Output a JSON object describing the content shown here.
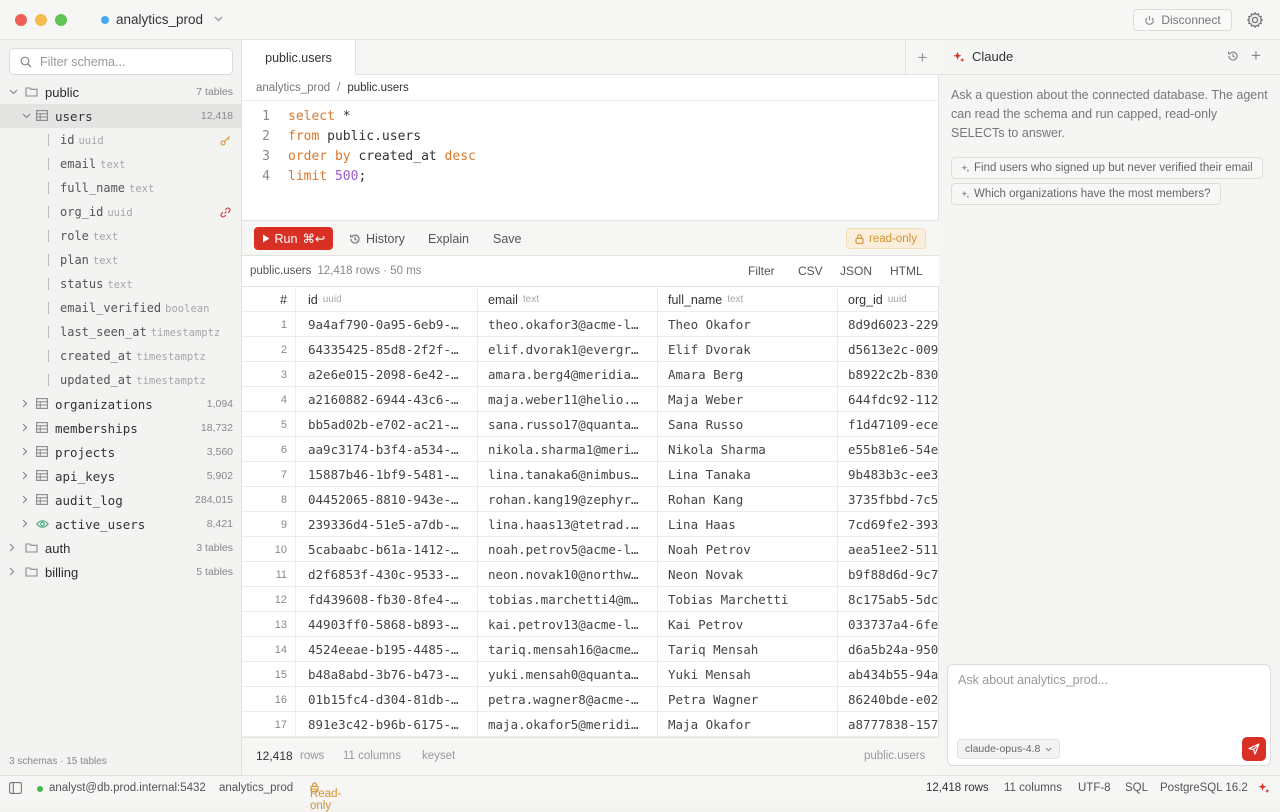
{
  "window": {
    "connection_name": "analytics_prod",
    "disconnect_label": "Disconnect",
    "connection_dot_color": "#45a8f0"
  },
  "sidebar": {
    "filter_placeholder": "Filter schema...",
    "schemas": [
      {
        "name": "public",
        "count": "7 tables"
      },
      {
        "name": "auth",
        "count": "3 tables"
      },
      {
        "name": "billing",
        "count": "5 tables"
      }
    ],
    "selected_table": {
      "name": "users",
      "count": "12,418"
    },
    "columns": [
      {
        "name": "id",
        "type": "uuid",
        "key": "primary-key"
      },
      {
        "name": "email",
        "type": "text"
      },
      {
        "name": "full_name",
        "type": "text"
      },
      {
        "name": "org_id",
        "type": "uuid",
        "key": "foreign-key"
      },
      {
        "name": "role",
        "type": "text"
      },
      {
        "name": "plan",
        "type": "text"
      },
      {
        "name": "status",
        "type": "text"
      },
      {
        "name": "email_verified",
        "type": "boolean"
      },
      {
        "name": "last_seen_at",
        "type": "timestamptz"
      },
      {
        "name": "created_at",
        "type": "timestamptz"
      },
      {
        "name": "updated_at",
        "type": "timestamptz"
      }
    ],
    "tables": [
      {
        "name": "organizations",
        "count": "1,094",
        "icon": "table-icon"
      },
      {
        "name": "memberships",
        "count": "18,732",
        "icon": "table-icon"
      },
      {
        "name": "projects",
        "count": "3,560",
        "icon": "table-icon"
      },
      {
        "name": "api_keys",
        "count": "5,902",
        "icon": "table-icon"
      },
      {
        "name": "audit_log",
        "count": "284,015",
        "icon": "table-icon"
      },
      {
        "name": "active_users",
        "count": "8,421",
        "icon": "view-icon"
      }
    ],
    "footer": "3 schemas · 15 tables"
  },
  "editor": {
    "tab_label": "public.users",
    "breadcrumb": [
      "analytics_prod",
      "/",
      "public.users"
    ],
    "lines": [
      "1",
      "2",
      "3",
      "4"
    ],
    "toolbar": {
      "run_label": "Run",
      "run_shortcut": "⌘↩",
      "history_label": "History",
      "explain_label": "Explain",
      "save_label": "Save",
      "readonly_label": "read-only"
    }
  },
  "results": {
    "source": "public.users",
    "meta": "12,418 rows · 50 ms",
    "exports": [
      "Filter",
      "CSV",
      "JSON",
      "HTML"
    ],
    "row_header": "#",
    "columns": [
      {
        "name": "id",
        "type": "uuid"
      },
      {
        "name": "email",
        "type": "text"
      },
      {
        "name": "full_name",
        "type": "text"
      },
      {
        "name": "org_id",
        "type": "uuid"
      }
    ],
    "rows": [
      [
        "1",
        "9a4af790-0a95-6eb9-…",
        "theo.okafor3@acme-l…",
        "Theo Okafor",
        "8d9d6023-229"
      ],
      [
        "2",
        "64335425-85d8-2f2f-…",
        "elif.dvorak1@evergr…",
        "Elif Dvorak",
        "d5613e2c-009"
      ],
      [
        "3",
        "a2e6e015-2098-6e42-…",
        "amara.berg4@meridia…",
        "Amara Berg",
        "b8922c2b-830"
      ],
      [
        "4",
        "a2160882-6944-43c6-…",
        "maja.weber11@helio.…",
        "Maja Weber",
        "644fdc92-112"
      ],
      [
        "5",
        "bb5ad02b-e702-ac21-…",
        "sana.russo17@quanta…",
        "Sana Russo",
        "f1d47109-ece"
      ],
      [
        "6",
        "aa9c3174-b3f4-a534-…",
        "nikola.sharma1@meri…",
        "Nikola Sharma",
        "e55b81e6-54e"
      ],
      [
        "7",
        "15887b46-1bf9-5481-…",
        "lina.tanaka6@nimbus…",
        "Lina Tanaka",
        "9b483b3c-ee3"
      ],
      [
        "8",
        "04452065-8810-943e-…",
        "rohan.kang19@zephyr…",
        "Rohan Kang",
        "3735fbbd-7c5"
      ],
      [
        "9",
        "239336d4-51e5-a7db-…",
        "lina.haas13@tetrad.…",
        "Lina Haas",
        "7cd69fe2-393"
      ],
      [
        "10",
        "5cabaabc-b61a-1412-…",
        "noah.petrov5@acme-l…",
        "Noah Petrov",
        "aea51ee2-511"
      ],
      [
        "11",
        "d2f6853f-430c-9533-…",
        "neon.novak10@northw…",
        "Neon Novak",
        "b9f88d6d-9c7"
      ],
      [
        "12",
        "fd439608-fb30-8fe4-…",
        "tobias.marchetti4@m…",
        "Tobias Marchetti",
        "8c175ab5-5dc"
      ],
      [
        "13",
        "44903ff0-5868-b893-…",
        "kai.petrov13@acme-l…",
        "Kai Petrov",
        "033737a4-6fe"
      ],
      [
        "14",
        "4524eeae-b195-4485-…",
        "tariq.mensah16@acme…",
        "Tariq Mensah",
        "d6a5b24a-950"
      ],
      [
        "15",
        "b48a8abd-3b76-b473-…",
        "yuki.mensah0@quanta…",
        "Yuki Mensah",
        "ab434b55-94a"
      ],
      [
        "16",
        "01b15fc4-d304-81db-…",
        "petra.wagner8@acme-…",
        "Petra Wagner",
        "86240bde-e02"
      ],
      [
        "17",
        "891e3c42-b96b-6175-…",
        "maja.okafor5@meridi…",
        "Maja Okafor",
        "a8777838-157"
      ]
    ],
    "footer": {
      "count": "12,418",
      "rows_label": "rows",
      "columns": "11 columns",
      "pagination": "keyset",
      "source": "public.users"
    }
  },
  "assistant": {
    "title": "Claude",
    "intro": "Ask a question about the connected database. The agent can read the schema and run capped, read-only SELECTs to answer.",
    "suggestions": [
      "Find users who signed up but never verified their email",
      "Which organizations have the most members?"
    ],
    "input_placeholder": "Ask about analytics_prod...",
    "model": "claude-opus-4.8",
    "accent_color": "#d93025"
  },
  "statusbar": {
    "user": "analyst@db.prod.internal:5432",
    "database": "analytics_prod",
    "mode": "Read-only",
    "rows": "12,418 rows",
    "columns": "11 columns",
    "encoding": "UTF-8",
    "language": "SQL",
    "server": "PostgreSQL 16.2"
  }
}
